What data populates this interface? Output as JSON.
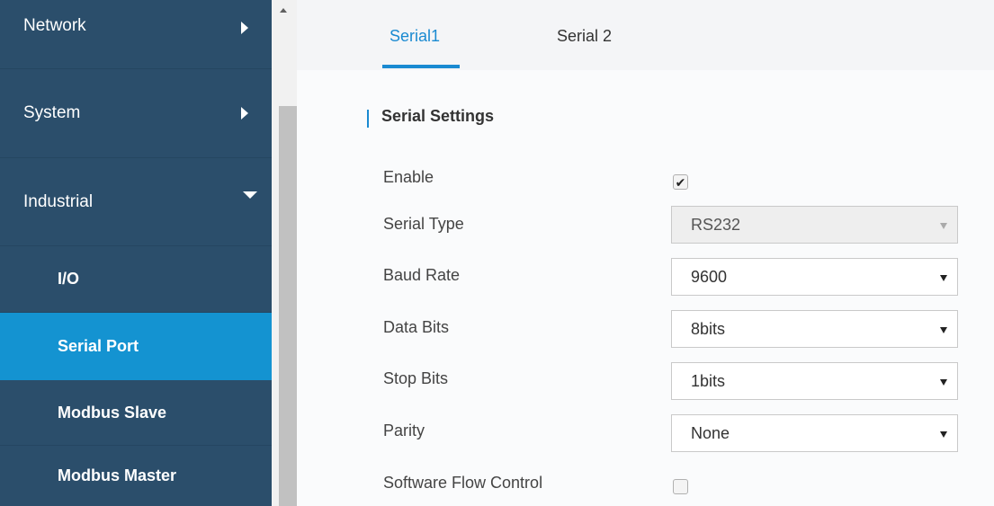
{
  "sidebar": {
    "items": [
      {
        "label": "Network",
        "icon": "chevron-right-icon"
      },
      {
        "label": "System",
        "icon": "chevron-right-icon"
      },
      {
        "label": "Industrial",
        "icon": "chevron-down-icon"
      },
      {
        "label": "I/O"
      },
      {
        "label": "Serial Port",
        "active": true
      },
      {
        "label": "Modbus Slave"
      },
      {
        "label": "Modbus Master"
      }
    ]
  },
  "tabs": [
    {
      "label": "Serial1",
      "active": true
    },
    {
      "label": "Serial 2"
    }
  ],
  "section": {
    "title": "Serial Settings"
  },
  "form": {
    "enable": {
      "label": "Enable",
      "checked": true
    },
    "serial_type": {
      "label": "Serial Type",
      "value": "RS232",
      "disabled": true
    },
    "baud_rate": {
      "label": "Baud Rate",
      "value": "9600"
    },
    "data_bits": {
      "label": "Data Bits",
      "value": "8bits"
    },
    "stop_bits": {
      "label": "Stop Bits",
      "value": "1bits"
    },
    "parity": {
      "label": "Parity",
      "value": "None"
    },
    "software_flow_control": {
      "label": "Software Flow Control",
      "checked": false
    }
  },
  "colors": {
    "sidebar_bg": "#2b4e6b",
    "active_item": "#1493d1",
    "accent": "#1a8ad1"
  }
}
